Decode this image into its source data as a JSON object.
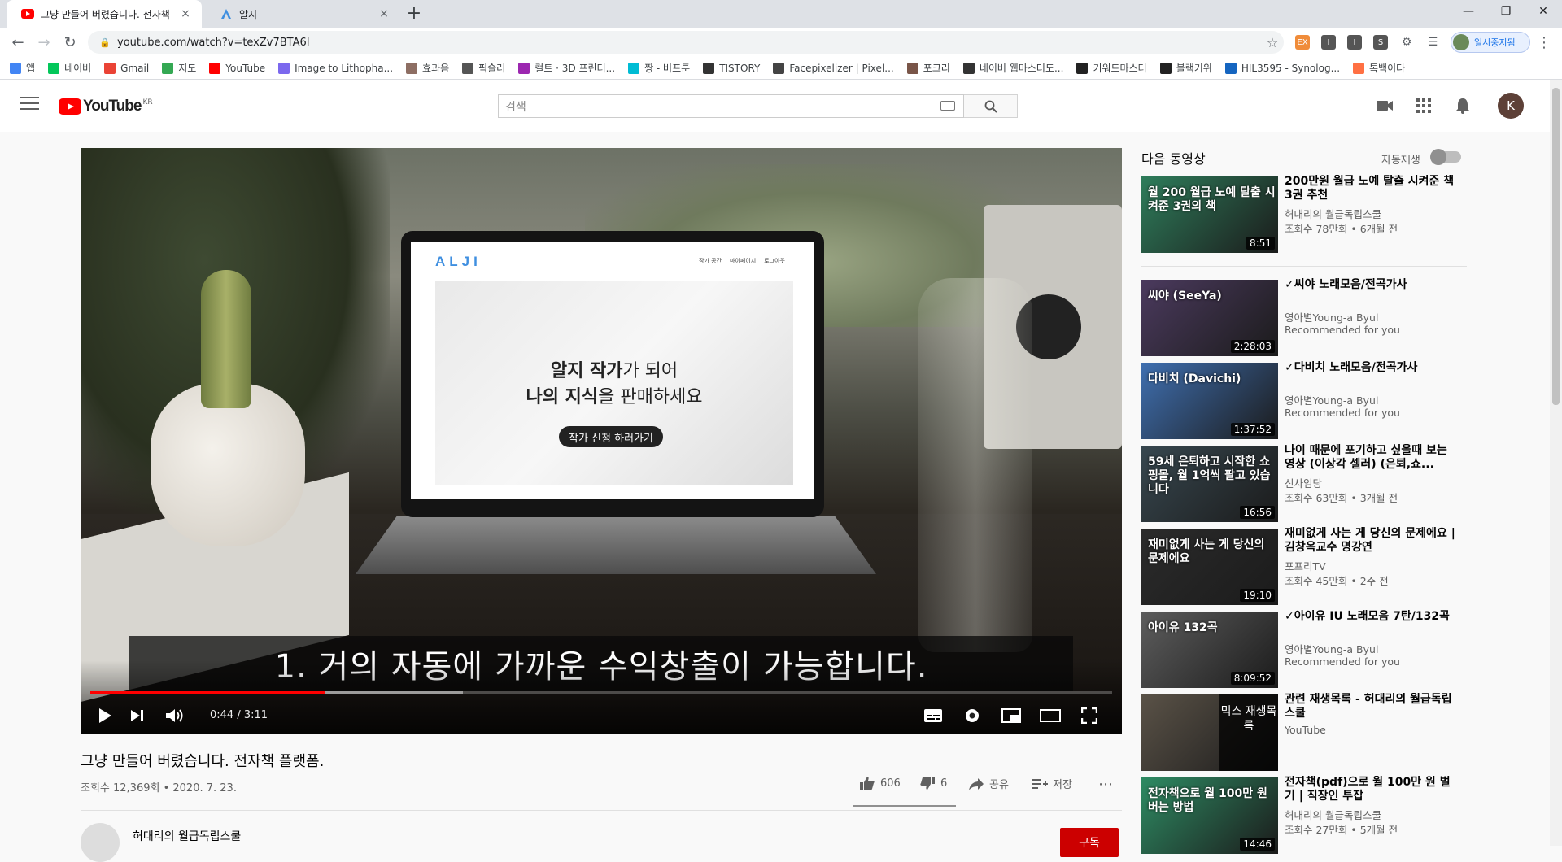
{
  "browser": {
    "tabs": [
      {
        "title": "그냥 만들어 버렸습니다. 전자책",
        "close": "×",
        "favicon": "youtube-icon"
      },
      {
        "title": "알지",
        "close": "×",
        "favicon": "alji-icon"
      }
    ],
    "new_tab": "+",
    "url": "youtube.com/watch?v=texZv7BTA6I",
    "profile_label": "일시중지됨",
    "bookmarks": [
      {
        "label": "앱",
        "color": "#4285f4"
      },
      {
        "label": "네이버",
        "color": "#03c75a"
      },
      {
        "label": "Gmail",
        "color": "#ea4335"
      },
      {
        "label": "지도",
        "color": "#34a853"
      },
      {
        "label": "YouTube",
        "color": "#ff0000"
      },
      {
        "label": "Image to Lithopha...",
        "color": "#7b68ee"
      },
      {
        "label": "효과음",
        "color": "#8d6e63"
      },
      {
        "label": "픽슬러",
        "color": "#555555"
      },
      {
        "label": "컬트 · 3D 프린터...",
        "color": "#9c27b0"
      },
      {
        "label": "짱 - 버프툰",
        "color": "#00bcd4"
      },
      {
        "label": "TISTORY",
        "color": "#333333"
      },
      {
        "label": "Facepixelizer | Pixel...",
        "color": "#444444"
      },
      {
        "label": "포크리",
        "color": "#795548"
      },
      {
        "label": "네이버 웹마스터도...",
        "color": "#333333"
      },
      {
        "label": "키워드마스터",
        "color": "#222222"
      },
      {
        "label": "블랙키위",
        "color": "#222222"
      },
      {
        "label": "HIL3595 - Synolog...",
        "color": "#1565c0"
      },
      {
        "label": "톡백이다",
        "color": "#ff7043"
      }
    ]
  },
  "yt": {
    "logo": "YouTube",
    "region": "KR",
    "search_placeholder": "검색",
    "avatar_letter": "K"
  },
  "video": {
    "laptop_brand": "ALJI",
    "laptop_nav": [
      "작가 공간",
      "마이페이지",
      "로그아웃"
    ],
    "laptop_line1_bold": "알지 작가",
    "laptop_line1_rest": "가 되어",
    "laptop_line2_bold": "나의 지식",
    "laptop_line2_rest": "을 판매하세요",
    "laptop_button": "작가 신청 하러가기",
    "subtitle": "1. 거의 자동에 가까운 수익창출이 가능합니다.",
    "time": "0:44 / 3:11",
    "progress_played": 0.23,
    "progress_buffered": 0.365,
    "title": "그냥 만들어 버렸습니다. 전자책 플랫폼.",
    "meta": "조회수 12,369회 • 2020. 7. 23.",
    "likes": "606",
    "dislikes": "6",
    "share": "공유",
    "save": "저장",
    "channel": "허대리의 월급독립스쿨",
    "subscribe": "구독"
  },
  "sidebar": {
    "heading": "다음 동영상",
    "autoplay": "자동재생",
    "items": [
      {
        "title": "200만원 월급 노예 탈출 시켜준 책 3권 추천",
        "channel": "허대리의 월급독립스쿨",
        "meta": "조회수 78만회 • 6개월 전",
        "duration": "8:51",
        "thumb_text": "월 200 월급 노예 탈출 시켜준 3권의 책",
        "thumb_color": "#2e7d5b"
      },
      {
        "title": "✓씨야 노래모음/전곡가사",
        "channel": "영아별Young-a Byul",
        "meta": "Recommended for you",
        "duration": "2:28:03",
        "thumb_text": "씨야 (SeeYa)",
        "thumb_color": "#4b3a5e"
      },
      {
        "title": "✓다비치 노래모음/전곡가사",
        "channel": "영아별Young-a Byul",
        "meta": "Recommended for you",
        "duration": "1:37:52",
        "thumb_text": "다비치 (Davichi)",
        "thumb_color": "#3f6fb0"
      },
      {
        "title": "나이 때문에 포기하고 싶을때 보는 영상 (이상각 셀러) (은퇴,쇼...",
        "channel": "신사임당",
        "meta": "조회수 63만회 • 3개월 전",
        "duration": "16:56",
        "thumb_text": "59세 은퇴하고 시작한 쇼핑몰, 월 1억씩 팔고 있습니다",
        "thumb_color": "#37474f"
      },
      {
        "title": "재미없게 사는 게 당신의 문제에요 | 김창옥교수 명강연",
        "channel": "포프리TV",
        "meta": "조회수 45만회 • 2주 전",
        "duration": "19:10",
        "thumb_text": "재미없게 사는 게 당신의 문제에요",
        "thumb_color": "#2b2b2b"
      },
      {
        "title": "✓아이유 IU 노래모음 7탄/132곡",
        "channel": "영아별Young-a Byul",
        "meta": "Recommended for you",
        "duration": "8:09:52",
        "thumb_text": "아이유 132곡",
        "thumb_color": "#5d5d5d"
      },
      {
        "title": "관련 재생목록 - 허대리의 월급독립스쿨",
        "channel": "YouTube",
        "meta": "",
        "duration": "",
        "thumb_text": "",
        "thumb_color": "#5a5247",
        "playlist": "믹스 재생목록"
      },
      {
        "title": "전자책(pdf)으로 월 100만 원 벌기 | 직장인 투잡",
        "channel": "허대리의 월급독립스쿨",
        "meta": "조회수 27만회 • 5개월 전",
        "duration": "14:46",
        "thumb_text": "전자책으로 월 100만 원 버는 방법",
        "thumb_color": "#2e8b63"
      }
    ]
  }
}
